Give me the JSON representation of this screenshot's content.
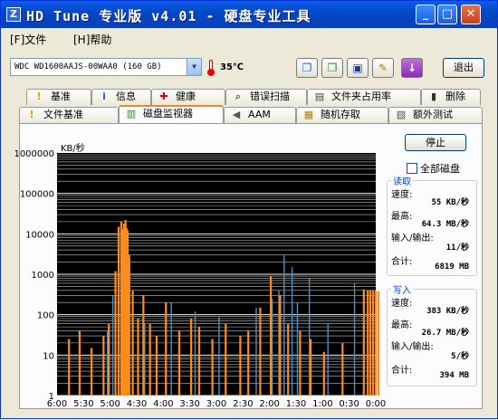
{
  "window": {
    "title": "HD Tune 专业版 v4.01 - 硬盘专业工具",
    "icon_letter": "Z",
    "min_label": "_",
    "max_label": "□",
    "close_label": "✕"
  },
  "menu": {
    "file": "[F]文件",
    "help": "[H]帮助"
  },
  "toolbar": {
    "drive": "WDC WD1600AAJS-00WAA0 (160 GB)",
    "temperature": "35℃",
    "icons": [
      "copy-icon",
      "copy-screenshot-icon",
      "save-icon",
      "options-icon",
      "download-icon"
    ],
    "exit_label": "退出"
  },
  "tabs_row1": [
    {
      "label": "基准",
      "icon": "!"
    },
    {
      "label": "信息",
      "icon": "i"
    },
    {
      "label": "健康",
      "icon": "+"
    },
    {
      "label": "错误扫描",
      "icon": "⌕"
    },
    {
      "label": "文件夹占用率",
      "icon": "▤"
    },
    {
      "label": "删除",
      "icon": "▮"
    }
  ],
  "tabs_row2": [
    {
      "label": "文件基准",
      "icon": "!"
    },
    {
      "label": "磁盘监视器",
      "icon": "▥"
    },
    {
      "label": "AAM",
      "icon": "◀"
    },
    {
      "label": "随机存取",
      "icon": "▦"
    },
    {
      "label": "额外测试",
      "icon": "▧"
    }
  ],
  "monitor": {
    "unit_label": "KB/秒",
    "stop_label": "停止",
    "all_disks_label": "全部磁盘",
    "read": {
      "title": "读取",
      "rows": [
        {
          "label": "速度:",
          "value": "55 KB/秒"
        },
        {
          "label": "最高:",
          "value": "64.3 MB/秒"
        },
        {
          "label": "输入/输出:",
          "value": "11/秒"
        },
        {
          "label": "合计:",
          "value": "6819 MB"
        }
      ]
    },
    "write": {
      "title": "写入",
      "rows": [
        {
          "label": "速度:",
          "value": "383 KB/秒"
        },
        {
          "label": "最高:",
          "value": "26.7 MB/秒"
        },
        {
          "label": "输入/输出:",
          "value": "5/秒"
        },
        {
          "label": "合计:",
          "value": "394 MB"
        }
      ]
    }
  },
  "chart_data": {
    "type": "bar",
    "y_scale": "log",
    "ylim": [
      1,
      1000000
    ],
    "ylabel": "KB/秒",
    "y_ticks": [
      "1000000",
      "100000",
      "10000",
      "1000",
      "100",
      "10",
      "1"
    ],
    "x_ticks": [
      "6:00",
      "5:30",
      "5:00",
      "4:30",
      "4:00",
      "3:30",
      "3:00",
      "2:30",
      "2:00",
      "1:30",
      "1:00",
      "0:30",
      "0:00"
    ],
    "colors": {
      "background": "#000000",
      "grid": "#ffffff",
      "read": "#4a90c8",
      "write": "#ff8c1a"
    },
    "series": [
      {
        "name": "读取",
        "color": "#4a90c8",
        "x": [
          1.9,
          2.1,
          2.45,
          2.53,
          2.56,
          2.6,
          3.3,
          4.3,
          5.2,
          6.1,
          7.5,
          8.1,
          8.35,
          8.55,
          8.85,
          9.05,
          9.5,
          10.2,
          11.2
        ],
        "y": [
          40,
          300,
          3000,
          4000,
          8000,
          2500,
          60,
          200,
          120,
          90,
          150,
          250,
          400,
          3000,
          1500,
          200,
          800,
          60,
          600
        ]
      },
      {
        "name": "写入",
        "color": "#ff8c1a",
        "x": [
          0.45,
          0.85,
          1.3,
          1.75,
          1.95,
          2.2,
          2.32,
          2.42,
          2.48,
          2.52,
          2.55,
          2.58,
          2.62,
          2.66,
          2.72,
          2.85,
          3.05,
          3.25,
          3.5,
          3.75,
          4.1,
          4.6,
          5.05,
          5.35,
          5.85,
          6.35,
          6.9,
          7.2,
          7.65,
          8.05,
          8.4,
          8.7,
          9.15,
          9.55,
          10.05,
          10.75,
          11.55,
          11.7,
          11.8,
          11.9,
          12.0,
          12.1
        ],
        "y": [
          25,
          40,
          15,
          30,
          60,
          1200,
          15000,
          20000,
          13000,
          18000,
          16000,
          22000,
          14000,
          12000,
          3000,
          400,
          80,
          300,
          60,
          30,
          200,
          40,
          80,
          50,
          25,
          60,
          30,
          40,
          150,
          900,
          300,
          60,
          40,
          25,
          12,
          20,
          420,
          400,
          410,
          390,
          400,
          380
        ]
      }
    ]
  }
}
